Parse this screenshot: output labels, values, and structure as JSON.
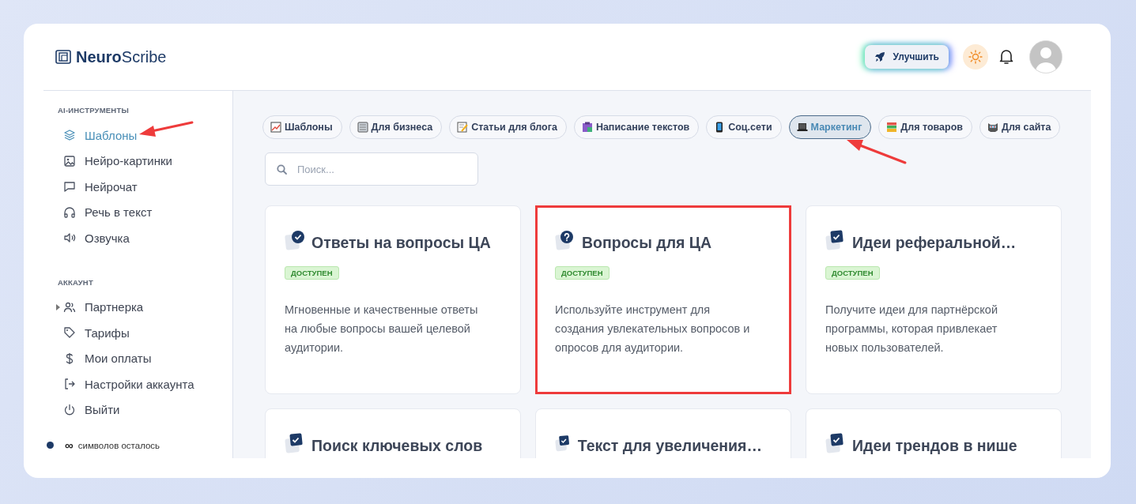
{
  "header": {
    "logo": "**Neuro**Scribe",
    "upgrade_button": "Улучшить"
  },
  "sidebar": {
    "sections": [
      {
        "title": "AI-ИНСТРУМЕНТЫ",
        "items": [
          {
            "label": "Шаблоны",
            "selected": true
          },
          {
            "label": "Нейро-картинки",
            "selected": false
          },
          {
            "label": "Нейрочат",
            "selected": false
          },
          {
            "label": "Речь в текст",
            "selected": false
          },
          {
            "label": "Озвучка",
            "selected": false
          }
        ]
      },
      {
        "title": "АККАУНТ",
        "items": [
          {
            "label": "Партнерка",
            "selected": false,
            "expanded": false
          },
          {
            "label": "Тарифы",
            "selected": false
          },
          {
            "label": "Мои оплаты",
            "selected": false
          },
          {
            "label": "Настройки аккаунта",
            "selected": false
          },
          {
            "label": "Выйти",
            "selected": false
          }
        ]
      }
    ],
    "footer": {
      "amount": "∞",
      "label": "символов осталось"
    }
  },
  "chips": [
    {
      "label": "Шаблоны",
      "selected": false
    },
    {
      "label": "Для бизнеса",
      "selected": false
    },
    {
      "label": "Статьи для блога",
      "selected": false
    },
    {
      "label": "Написание текстов",
      "selected": false
    },
    {
      "label": "Соц.сети",
      "selected": false
    },
    {
      "label": "Маркетинг",
      "selected": true
    },
    {
      "label": "Для товаров",
      "selected": false
    },
    {
      "label": "Для сайта",
      "selected": false
    }
  ],
  "search": {
    "placeholder": "Поиск..."
  },
  "cards": [
    {
      "kind": "check-circle",
      "title": "Ответы на вопросы ЦА",
      "badge": "ДОСТУПЕН",
      "description": "Мгновенные и качественные ответы на любые вопросы вашей целевой аудитории.",
      "highlighted": false
    },
    {
      "kind": "question",
      "title": "Вопросы для ЦА",
      "badge": "ДОСТУПЕН",
      "description": "Используйте инструмент для создания увлекательных вопросов и опросов для аудитории.",
      "highlighted": true
    },
    {
      "kind": "check-square",
      "title": "Идеи реферальной…",
      "badge": "ДОСТУПЕН",
      "description": "Получите идеи для партнёрской программы, которая привлекает новых пользователей.",
      "highlighted": false
    },
    {
      "kind": "check-square",
      "title": "Поиск ключевых слов",
      "highlighted": false
    },
    {
      "kind": "check-square",
      "title": "Текст для увеличения…",
      "highlighted": false
    },
    {
      "kind": "check-square",
      "title": "Идеи трендов в нише",
      "highlighted": false
    }
  ]
}
